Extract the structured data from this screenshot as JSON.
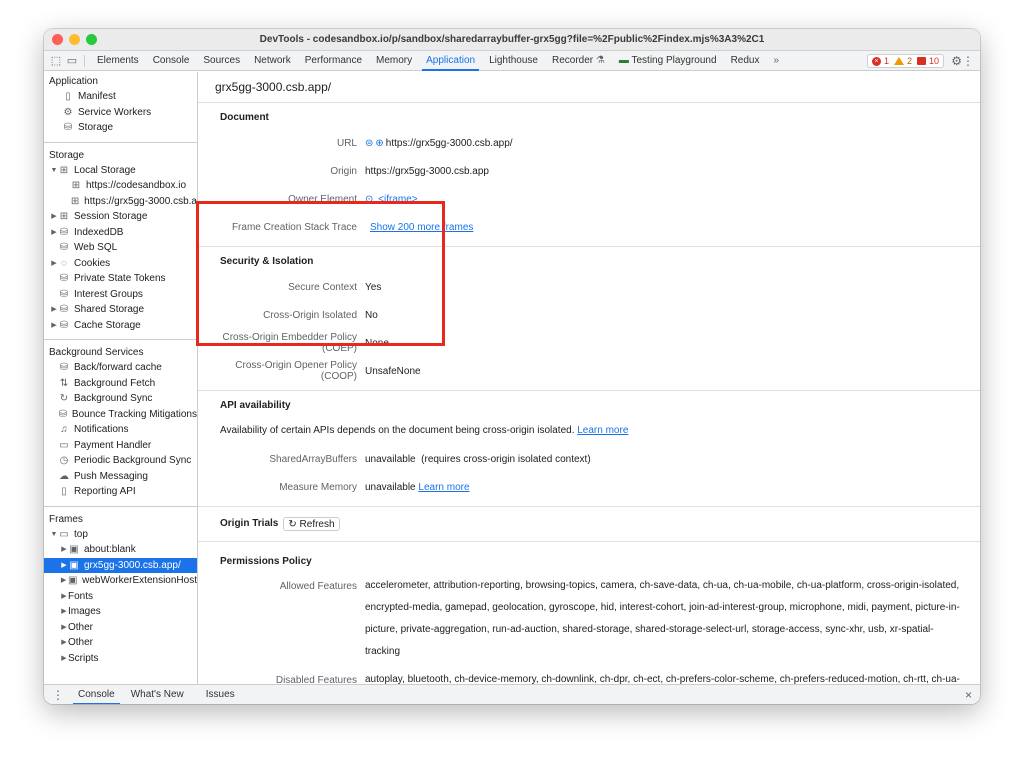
{
  "window": {
    "title": "DevTools - codesandbox.io/p/sandbox/sharedarraybuffer-grx5gg?file=%2Fpublic%2Findex.mjs%3A3%2C1",
    "traffic_lights": [
      "#ff5f57",
      "#febc2e",
      "#28c840"
    ]
  },
  "toolbar": {
    "tabs": [
      "Elements",
      "Console",
      "Sources",
      "Network",
      "Performance",
      "Memory",
      "Application",
      "Lighthouse",
      "Recorder",
      "Testing Playground",
      "Redux"
    ],
    "active_tab": "Application",
    "more": "»",
    "errors": "1",
    "warnings": "2",
    "issues": "10",
    "icons": [
      "inspect-icon",
      "device-toggle-icon",
      "flask-icon",
      "puzzle-icon",
      "gear-icon",
      "kebab-icon"
    ]
  },
  "sidebar": {
    "application": {
      "heading": "Application",
      "items": [
        "Manifest",
        "Service Workers",
        "Storage"
      ]
    },
    "storage": {
      "heading": "Storage",
      "local_storage": "Local Storage",
      "local_children": [
        "https://codesandbox.io",
        "https://grx5gg-3000.csb.a"
      ],
      "items": [
        "Session Storage",
        "IndexedDB",
        "Web SQL",
        "Cookies",
        "Private State Tokens",
        "Interest Groups",
        "Shared Storage",
        "Cache Storage"
      ]
    },
    "background": {
      "heading": "Background Services",
      "items": [
        "Back/forward cache",
        "Background Fetch",
        "Background Sync",
        "Bounce Tracking Mitigations",
        "Notifications",
        "Payment Handler",
        "Periodic Background Sync",
        "Push Messaging",
        "Reporting API"
      ]
    },
    "frames": {
      "heading": "Frames",
      "top": "top",
      "children": [
        "about:blank",
        "grx5gg-3000.csb.app/",
        "webWorkerExtensionHost"
      ],
      "sub": [
        "Fonts",
        "Images",
        "Other",
        "Other",
        "Scripts"
      ]
    }
  },
  "main": {
    "header": "grx5gg-3000.csb.app/",
    "document": {
      "title": "Document",
      "url_label": "URL",
      "url_value": "https://grx5gg-3000.csb.app/",
      "origin_label": "Origin",
      "origin_value": "https://grx5gg-3000.csb.app",
      "owner_label": "Owner Element",
      "owner_value": "<iframe>",
      "stack_label": "Frame Creation Stack Trace",
      "stack_value": "Show 200 more frames"
    },
    "security": {
      "title": "Security & Isolation",
      "secure_label": "Secure Context",
      "secure_value": "Yes",
      "coi_label": "Cross-Origin Isolated",
      "coi_value": "No",
      "coep_label": "Cross-Origin Embedder Policy (COEP)",
      "coep_value": "None",
      "coop_label": "Cross-Origin Opener Policy (COOP)",
      "coop_value": "UnsafeNone"
    },
    "api": {
      "title": "API availability",
      "note": "Availability of certain APIs depends on the document being cross-origin isolated.",
      "learn_more": "Learn more",
      "sab_label": "SharedArrayBuffers",
      "sab_value": "unavailable  (requires cross-origin isolated context)",
      "mm_label": "Measure Memory",
      "mm_value": "unavailable",
      "mm_link": "Learn more"
    },
    "trials": {
      "title": "Origin Trials",
      "refresh": "Refresh"
    },
    "permissions": {
      "title": "Permissions Policy",
      "allowed_label": "Allowed Features",
      "allowed_value": "accelerometer, attribution-reporting, browsing-topics, camera, ch-save-data, ch-ua, ch-ua-mobile, ch-ua-platform, cross-origin-isolated, encrypted-media, gamepad, geolocation, gyroscope, hid, interest-cohort, join-ad-interest-group, microphone, midi, payment, picture-in-picture, private-aggregation, run-ad-auction, shared-storage, shared-storage-select-url, storage-access, sync-xhr, usb, xr-spatial-tracking",
      "disabled_label": "Disabled Features",
      "disabled_value": "autoplay, bluetooth, ch-device-memory, ch-downlink, ch-dpr, ch-ect, ch-prefers-color-scheme, ch-prefers-reduced-motion, ch-rtt, ch-ua-arch, ch-ua-bitness, ch-ua-full-version, ch-ua-full-version-list, ch-ua-model, ch-ua-platform-version, ch-ua-wow64, ch-viewport-height, ch-viewport-width,"
    }
  },
  "drawer": {
    "tabs": [
      "Console",
      "What's New",
      "Issues"
    ],
    "active": "Console",
    "close": "×"
  },
  "colors": {
    "accent": "#1a73e8",
    "highlight_border": "#e8281c",
    "selected_bg": "#1a73e8"
  }
}
